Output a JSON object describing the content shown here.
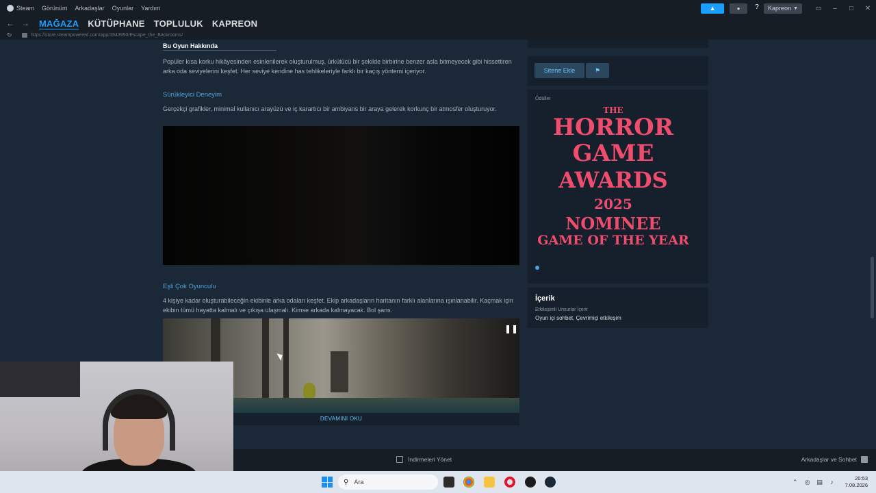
{
  "titlebar": {
    "menu": [
      "Steam",
      "Görünüm",
      "Arkadaşlar",
      "Oyunlar",
      "Yardım"
    ],
    "help": "?",
    "account": "Kapreon"
  },
  "nav": {
    "tabs": [
      "MAĞAZA",
      "KÜTÜPHANE",
      "TOPLULUK",
      "KAPREON"
    ],
    "url": "https://store.steampowered.com/app/1943950/Escape_the_Backrooms/"
  },
  "main": {
    "about_title": "Bu Oyun Hakkında",
    "about_text": "Popüler kısa korku hikâyesinden esinlenilerek oluşturulmuş, ürkütücü bir şekilde birbirine benzer asla bitmeyecek gibi hissettiren arka oda seviyelerini keşfet. Her seviye kendine has tehlikeleriyle farklı bir kaçış yöntemi içeriyor.",
    "section1_title": "Sürükleyici Deneyim",
    "section1_text": "Gerçekçi grafikler, minimal kullanıcı arayüzü ve iç karartıcı bir ambiyans bir araya gelerek korkunç bir atmosfer oluşturuyor.",
    "section2_title": "Eşli Çok Oyunculu",
    "section2_text": "4 kişiye kadar oluşturabileceğin ekibinle arka odaları keşfet. Ekip arkadaşların haritanın farklı alanlarına ışınlanabilir. Kaçmak için ekibin tümü hayatta kalmalı ve çıkışa ulaşmalı. Kimse arkada kalmayacak. Bol şans.",
    "read_more": "DEVAMINI OKU"
  },
  "sidebar": {
    "add_to_site": "Sitene Ekle",
    "awards_label": "Ödüller",
    "award_art": {
      "line1": "THE",
      "line2": "HORROR",
      "line3": "GAME",
      "line4": "AWARDS",
      "line5": "2025",
      "line6": "NOMINEE",
      "line7": "GAME OF THE YEAR"
    },
    "content_title": "İçerik",
    "content_sub": "Etkileşimli Unsurlar İçerir",
    "content_value": "Oyun içi sohbet, Çevrimiçi etkileşim"
  },
  "footer": {
    "downloads": "İndirmeleri Yönet",
    "friends": "Arkadaşlar ve Sohbet"
  },
  "taskbar": {
    "search_placeholder": "Ara",
    "time": "20:53",
    "date": "7.08.2026"
  },
  "colors": {
    "accent": "#1a9fff",
    "link": "#4fa3d8",
    "award": "#f04d6e"
  }
}
